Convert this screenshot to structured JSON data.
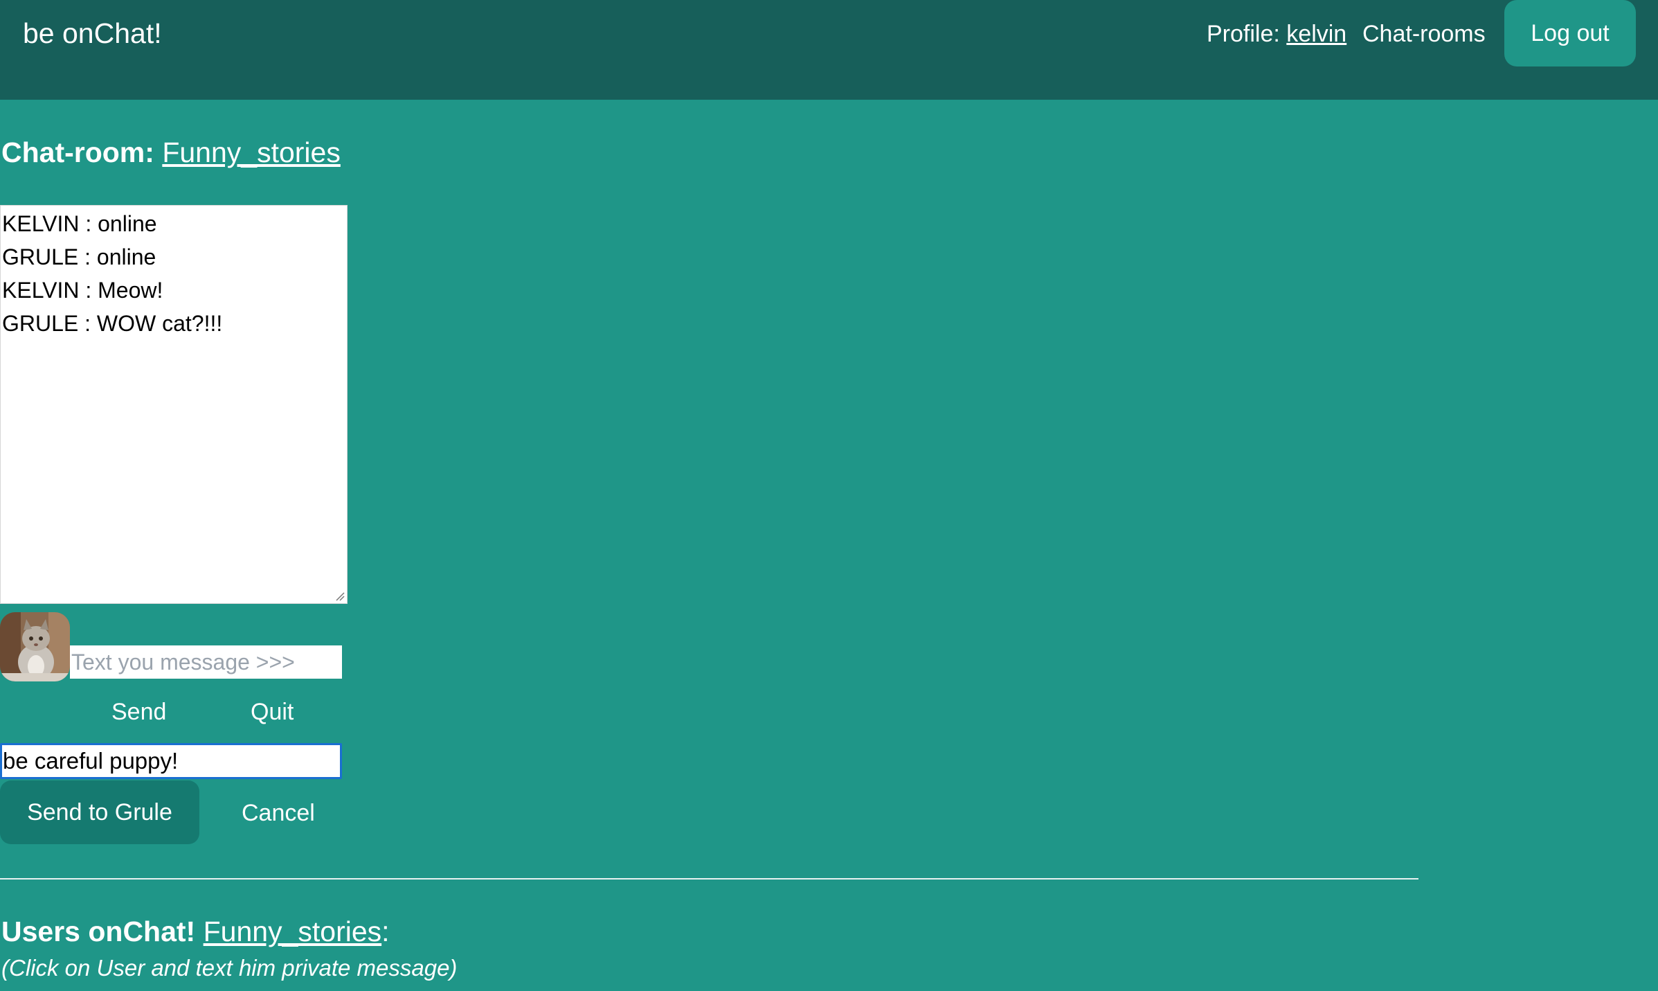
{
  "brand": "be onChat!",
  "nav": {
    "profile_label": "Profile:",
    "profile_user": "kelvin",
    "chatrooms": "Chat-rooms",
    "logout": "Log out"
  },
  "room": {
    "heading_label": "Chat-room:",
    "name": "Funny_stories"
  },
  "chat_log": [
    "KELVIN : online",
    "GRULE : online",
    "KELVIN : Meow!",
    "GRULE : WOW cat?!!!"
  ],
  "message_input": {
    "placeholder": "Text you message >>>",
    "value": ""
  },
  "buttons": {
    "send": "Send",
    "quit": "Quit",
    "send_private": "Send to Grule",
    "cancel": "Cancel"
  },
  "private_input": {
    "value": "be careful puppy!"
  },
  "users_section": {
    "heading_label": "Users onChat!",
    "room_name": "Funny_stories",
    "suffix": ":",
    "hint": "(Click on User and text him private message)"
  },
  "colors": {
    "page_bg": "#1f9688",
    "topbar_bg": "#175f5a",
    "send_private_bg": "#157a70",
    "focus_border": "#1a6fd1"
  },
  "icons": {
    "avatar": "cat-avatar-icon",
    "resize": "resize-grip-icon"
  }
}
